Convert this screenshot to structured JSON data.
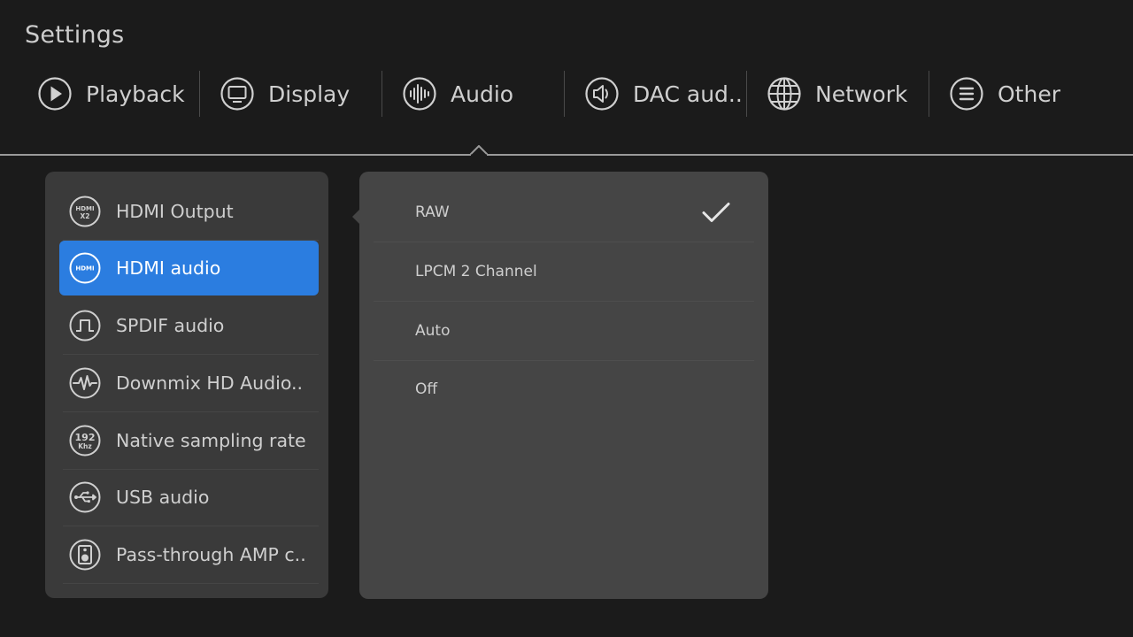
{
  "header": {
    "title": "Settings"
  },
  "tabs": [
    {
      "label": "Playback",
      "icon": "play-circle-icon"
    },
    {
      "label": "Display",
      "icon": "monitor-icon"
    },
    {
      "label": "Audio",
      "icon": "waveform-icon",
      "active": true
    },
    {
      "label": "DAC aud..",
      "icon": "speaker-icon"
    },
    {
      "label": "Network",
      "icon": "globe-icon"
    },
    {
      "label": "Other",
      "icon": "menu-lines-icon"
    }
  ],
  "menu": {
    "items": [
      {
        "label": "HDMI Output",
        "icon": "hdmi-x2-icon",
        "icon_text_top": "HDMI",
        "icon_text_bottom": "X2"
      },
      {
        "label": "HDMI audio",
        "icon": "hdmi-icon",
        "icon_text_top": "HDMI",
        "selected": true
      },
      {
        "label": "SPDIF audio",
        "icon": "square-wave-icon"
      },
      {
        "label": "Downmix HD Audio..",
        "icon": "pulse-wave-icon"
      },
      {
        "label": "Native sampling rate",
        "icon": "sample-rate-icon",
        "icon_text_top": "192",
        "icon_text_bottom": "Khz"
      },
      {
        "label": "USB audio",
        "icon": "usb-icon"
      },
      {
        "label": "Pass-through AMP c..",
        "icon": "amp-speaker-icon"
      }
    ]
  },
  "options": {
    "items": [
      {
        "label": "RAW",
        "checked": true
      },
      {
        "label": "LPCM 2 Channel",
        "checked": false
      },
      {
        "label": "Auto",
        "checked": false
      },
      {
        "label": "Off",
        "checked": false
      }
    ]
  },
  "colors": {
    "background": "#1b1b1b",
    "menu_panel": "#3a3a3a",
    "options_panel": "#454545",
    "accent": "#2b7de0",
    "text": "#cfcfcf"
  }
}
